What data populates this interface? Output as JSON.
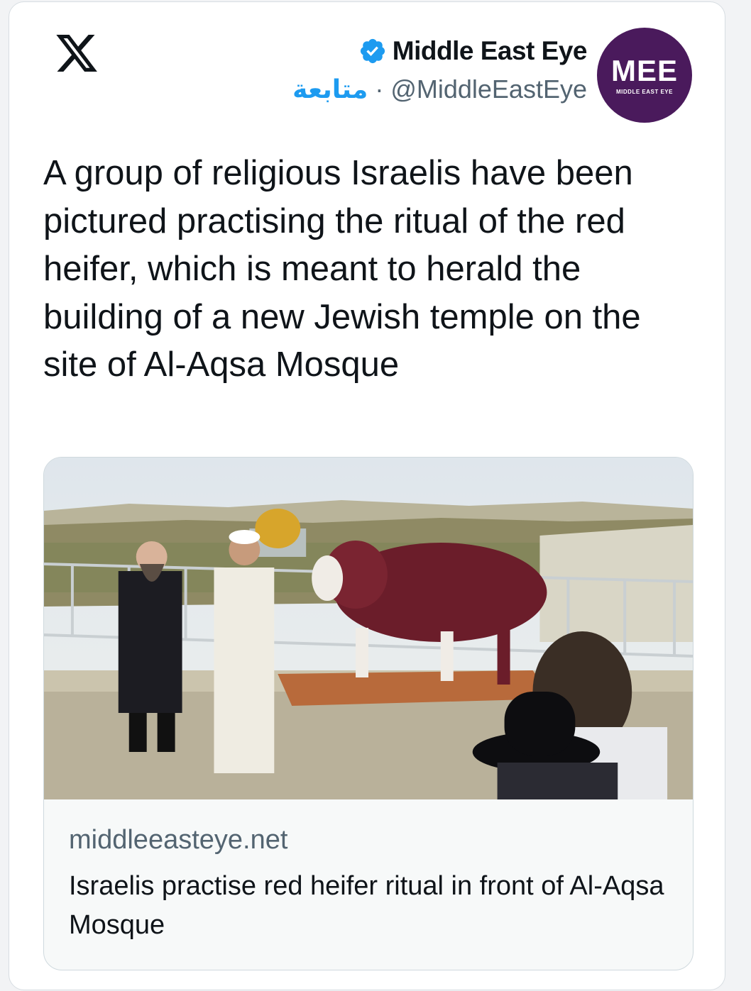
{
  "platform": {
    "logo_icon": "x-logo-icon"
  },
  "author": {
    "name": "Middle East Eye",
    "handle": "@MiddleEastEye",
    "separator": "·",
    "follow_label": "متابعة",
    "verified_icon": "verified-badge-icon",
    "avatar": {
      "mark": "MEE",
      "caption": "MIDDLE EAST EYE",
      "bg": "#4a1a5c"
    }
  },
  "tweet": {
    "text": "A group of religious Israelis have been pictured practising the ritual of the red heifer, which is meant to herald the building of a new Jewish temple on the site of Al-Aqsa Mosque"
  },
  "link_card": {
    "domain": "middleeasteye.net",
    "headline": "Israelis practise red heifer ritual in front of Al-Aqsa Mosque"
  },
  "colors": {
    "accent": "#1d9bf0",
    "text_primary": "#0f1419",
    "text_secondary": "#536471"
  }
}
